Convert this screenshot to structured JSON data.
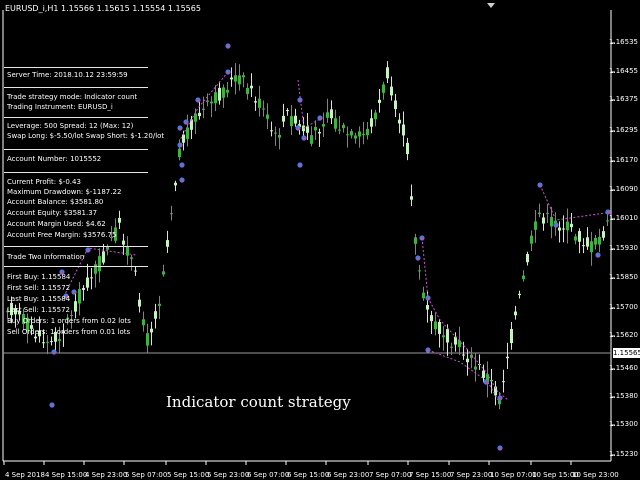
{
  "chart": {
    "title": "EURUSD_i,H1  1.15566 1.15615 1.15554 1.15565",
    "overlay_caption": "Indicator count strategy",
    "current_price": "1.15565",
    "colors": {
      "background": "#000000",
      "bull_candle": "#c4f3bd",
      "bear_candle": "#3bb53b",
      "trade_line": "#d84bd8",
      "grid_axis": "#ffffff",
      "bid_line": "#9a9a9a"
    },
    "price_labels": [
      "1.16535",
      "1.16455",
      "1.16375",
      "1.16295",
      "1.16170",
      "1.16090",
      "1.16010",
      "1.15930",
      "1.15850",
      "1.15700",
      "1.15620",
      "1.15565",
      "1.15460",
      "1.15380",
      "1.15300",
      "1.15230"
    ],
    "time_labels": [
      "4 Sep 2018",
      "4 Sep 15:00",
      "4 Sep 23:00",
      "5 Sep 07:00",
      "5 Sep 15:00",
      "5 Sep 23:00",
      "6 Sep 07:00",
      "6 Sep 15:00",
      "6 Sep 23:00",
      "7 Sep 07:00",
      "7 Sep 15:00",
      "7 Sep 23:00",
      "10 Sep 07:00",
      "10 Sep 15:00",
      "10 Sep 23:00"
    ]
  },
  "info_panel": {
    "server_time": "Server Time: 2018.10.12 23:59:59",
    "strategy_mode": "Trade strategy mode: Indicator count",
    "instrument": "Trading Instrument: EURUSD_i",
    "leverage_spread": "Leverage: 500   Spread: 12 (Max: 12)",
    "swap": "Swap Long: $-5.50/lot   Swap Short: $-1.20/lot",
    "account_number": "Account Number: 1015552",
    "current_profit": "Current Profit: $-0.43",
    "max_drawdown": "Maximum Drawdown: $-1187.22",
    "balance": "Account Balance: $3581.80",
    "equity": "Account Equity: $3581.37",
    "margin_used": "Account Margin Used: $4.62",
    "free_margin": "Account Free Margin: $3576.75",
    "trade_two": "Trade Two Information",
    "first_buy": "First Buy: 1.15584",
    "first_sell": "First Sell: 1.15572",
    "last_buy": "Last Buy: 1.15584",
    "last_sell": "Last Sell: 1.15572",
    "buy_orders": "Buy Orders: 1 orders from 0.02 lots",
    "sell_orders": "Sell Orders: 1 orders from 0.01 lots"
  }
}
